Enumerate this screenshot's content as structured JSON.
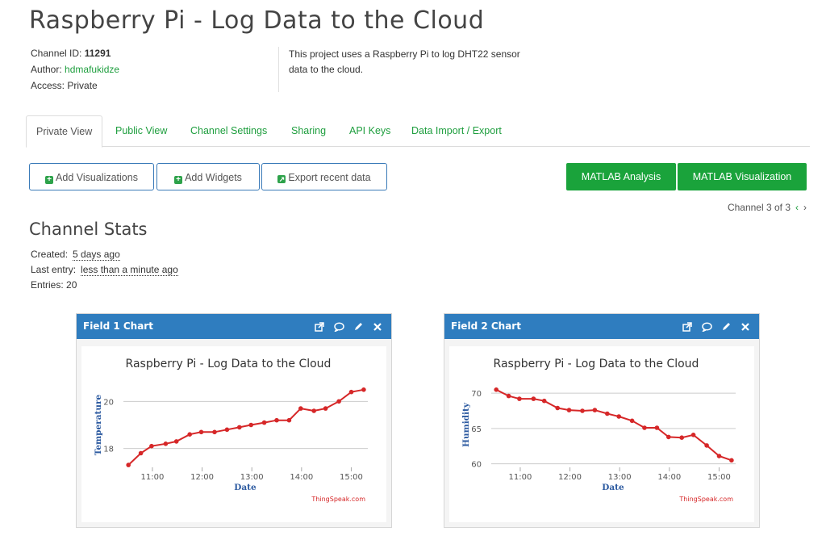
{
  "page": {
    "title": "Raspberry Pi - Log Data to the Cloud"
  },
  "meta": {
    "channel_id_label": "Channel ID:",
    "channel_id": "11291",
    "author_label": "Author:",
    "author": "hdmafukidze",
    "access_label": "Access:",
    "access": "Private",
    "description_line1": "This project uses a Raspberry Pi to log DHT22 sensor",
    "description_line2": "data to the cloud."
  },
  "tabs": [
    {
      "label": "Private View"
    },
    {
      "label": "Public View"
    },
    {
      "label": "Channel Settings"
    },
    {
      "label": "Sharing"
    },
    {
      "label": "API Keys"
    },
    {
      "label": "Data Import / Export"
    }
  ],
  "toolbar": {
    "add_visualizations": "Add Visualizations",
    "add_widgets": "Add Widgets",
    "export_recent": "Export recent data",
    "matlab_analysis": "MATLAB Analysis",
    "matlab_visualization": "MATLAB Visualization"
  },
  "pager": {
    "text": "Channel 3 of 3",
    "prev": "‹",
    "next": "›"
  },
  "stats": {
    "heading": "Channel Stats",
    "created_label": "Created:",
    "created": "5 days ago",
    "last_entry_label": "Last entry:",
    "last_entry": "less than a minute ago",
    "entries_label": "Entries:",
    "entries": "20"
  },
  "colors": {
    "accent_green": "#1aa33b",
    "panel_blue": "#2f7dbf",
    "series_red": "#d62728"
  },
  "panels": [
    {
      "title": "Field 1 Chart"
    },
    {
      "title": "Field 2 Chart"
    }
  ],
  "chart_data": [
    {
      "type": "line",
      "title": "Raspberry Pi - Log Data to the Cloud",
      "xlabel": "Date",
      "ylabel": "Temperature",
      "credit": "ThingSpeak.com",
      "x_ticks": [
        "11:00",
        "12:00",
        "13:00",
        "14:00",
        "15:00"
      ],
      "y_ticks": [
        18,
        20
      ],
      "ylim": [
        17.2,
        20.8
      ],
      "x": [
        "10:31",
        "10:46",
        "10:59",
        "11:16",
        "11:29",
        "11:45",
        "11:59",
        "12:15",
        "12:30",
        "12:45",
        "12:59",
        "13:15",
        "13:30",
        "13:45",
        "13:59",
        "14:15",
        "14:29",
        "14:45",
        "15:00",
        "15:15"
      ],
      "series": [
        {
          "values": [
            17.3,
            17.8,
            18.1,
            18.2,
            18.3,
            18.6,
            18.7,
            18.7,
            18.8,
            18.9,
            19.0,
            19.1,
            19.2,
            19.2,
            19.7,
            19.6,
            19.7,
            20.0,
            20.4,
            20.5
          ]
        }
      ],
      "grid": true
    },
    {
      "type": "line",
      "title": "Raspberry Pi - Log Data to the Cloud",
      "xlabel": "Date",
      "ylabel": "Humidity",
      "credit": "ThingSpeak.com",
      "x_ticks": [
        "11:00",
        "12:00",
        "13:00",
        "14:00",
        "15:00"
      ],
      "y_ticks": [
        60,
        65,
        70
      ],
      "ylim": [
        59.5,
        71.5
      ],
      "x": [
        "10:31",
        "10:46",
        "10:59",
        "11:16",
        "11:29",
        "11:45",
        "11:59",
        "12:15",
        "12:30",
        "12:45",
        "12:59",
        "13:15",
        "13:30",
        "13:45",
        "13:59",
        "14:15",
        "14:29",
        "14:45",
        "15:00",
        "15:15"
      ],
      "series": [
        {
          "values": [
            70.5,
            69.6,
            69.2,
            69.2,
            68.9,
            67.9,
            67.6,
            67.5,
            67.6,
            67.1,
            66.7,
            66.1,
            65.1,
            65.1,
            63.8,
            63.7,
            64.1,
            62.6,
            61.1,
            60.5
          ]
        }
      ],
      "grid": true
    }
  ]
}
